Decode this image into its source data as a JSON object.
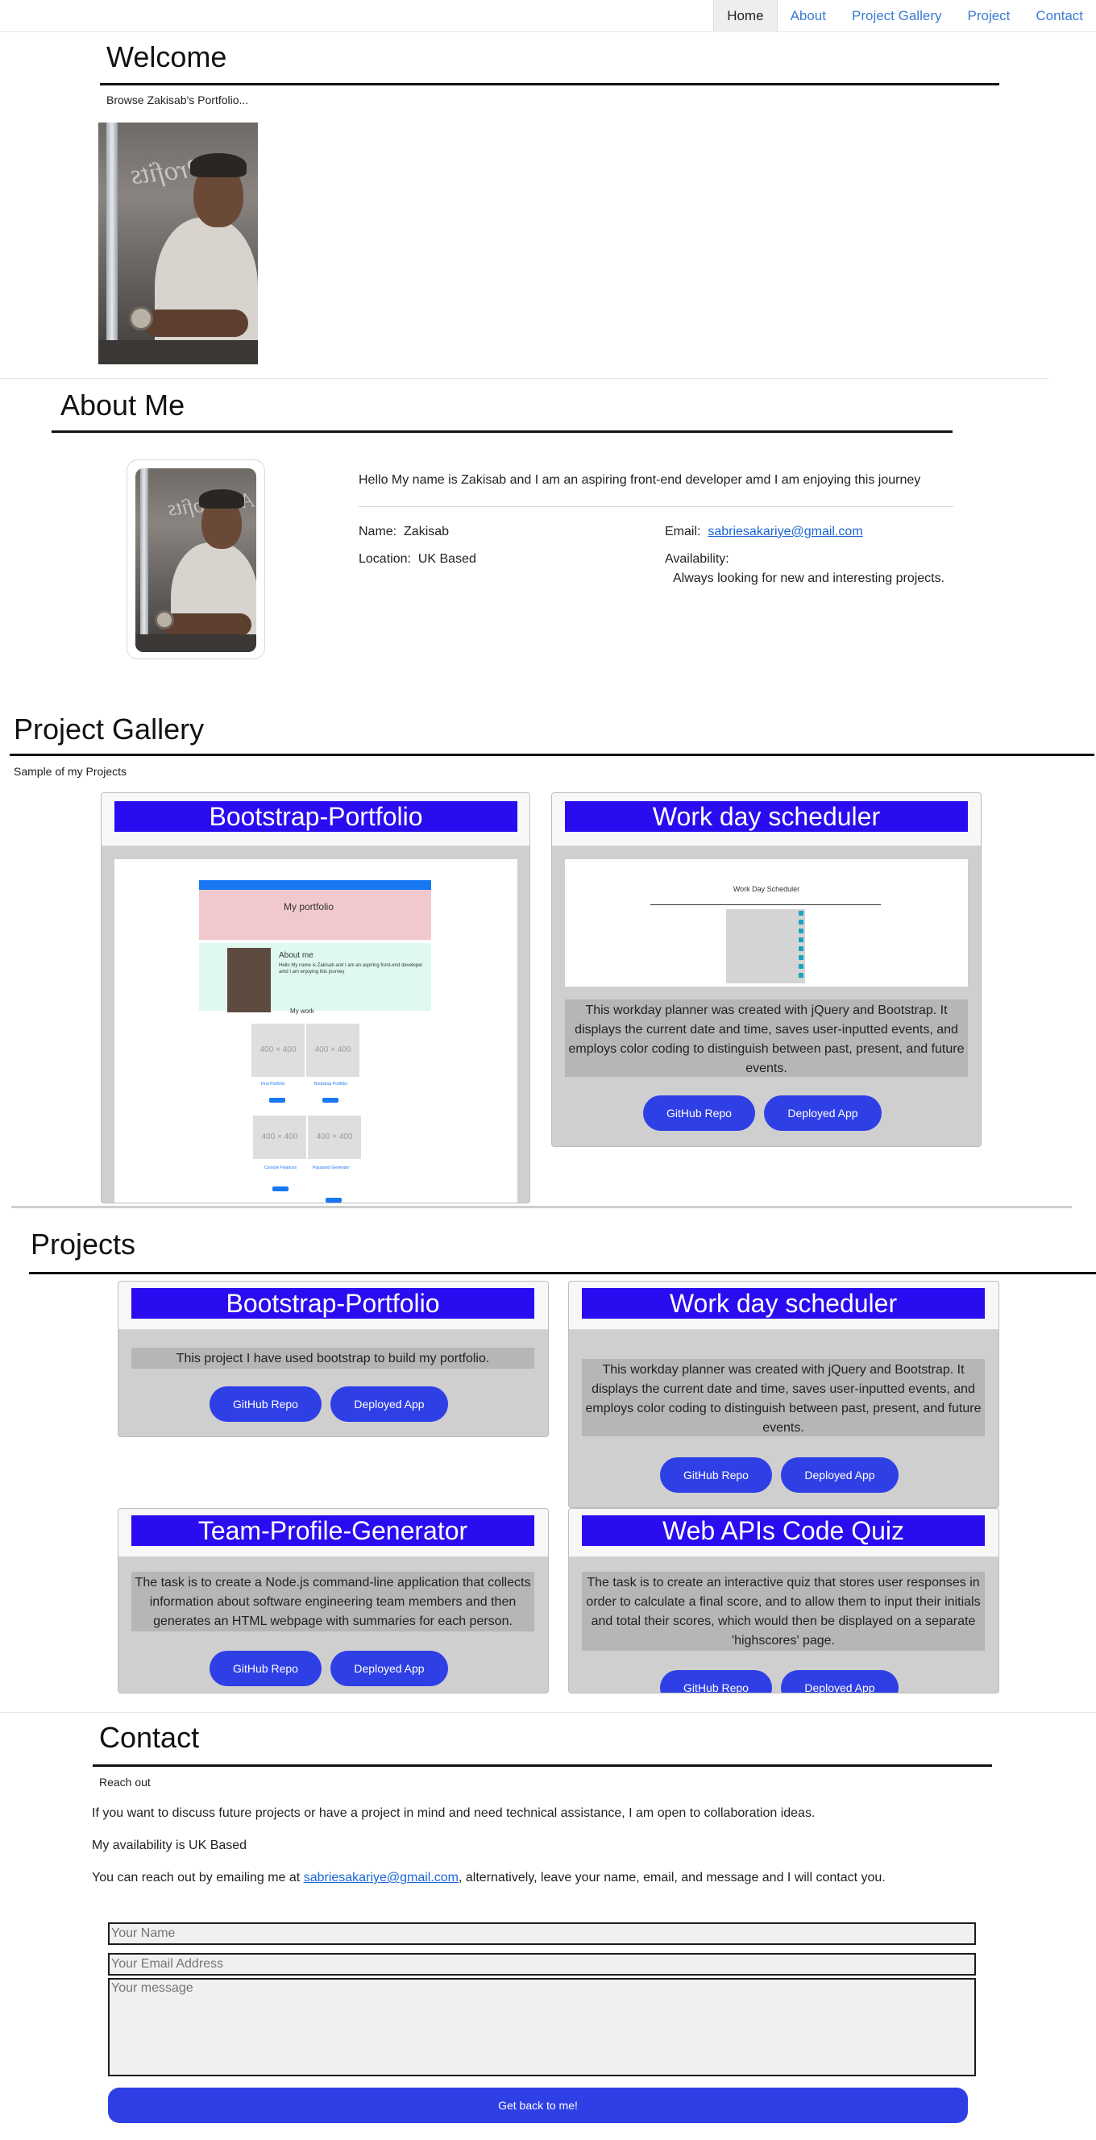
{
  "nav": {
    "items": [
      {
        "label": "Home",
        "active": true
      },
      {
        "label": "About",
        "active": false
      },
      {
        "label": "Project Gallery",
        "active": false
      },
      {
        "label": "Project",
        "active": false
      },
      {
        "label": "Contact",
        "active": false
      }
    ]
  },
  "welcome": {
    "title": "Welcome",
    "subtitle": "Browse Zakisab's Portfolio..."
  },
  "about": {
    "title": "About Me",
    "intro": "Hello My name is Zakisab and I am an aspiring front-end developer amd I am enjoying this journey",
    "name_label": "Name:",
    "name_value": "Zakisab",
    "location_label": "Location:",
    "location_value": "UK Based",
    "email_label": "Email:",
    "email_value": "sabriesakariye@gmail.com",
    "availability_label": "Availability:",
    "availability_value": "Always looking for new and interesting projects."
  },
  "gallery": {
    "title": "Project Gallery",
    "subtitle": "Sample of my Projects",
    "cards": [
      {
        "title": "Bootstrap-Portfolio",
        "preview": {
          "hero_title": "My portfolio",
          "about_title": "About me",
          "about_text": "Hello My name is Zakisab and I am an aspiring front-end developer amd I am enjoying this journey",
          "work_title": "My work",
          "tile_label": "400 × 400",
          "tile_names": [
            "First Portfolio",
            "Bootstrap Portfolio",
            "Console Finances",
            "Password Generator"
          ]
        }
      },
      {
        "title": "Work day scheduler",
        "preview": {
          "app_title": "Work Day Scheduler"
        },
        "description": "This workday planner was created with jQuery and Bootstrap. It displays the current date and time, saves user-inputted events, and employs color coding to distinguish between past, present, and future events.",
        "github_label": "GitHub Repo",
        "deployed_label": "Deployed App"
      }
    ]
  },
  "projects": {
    "title": "Projects",
    "cards": [
      {
        "title": "Bootstrap-Portfolio",
        "description": "This project I have used bootstrap to build my portfolio.",
        "github_label": "GitHub Repo",
        "deployed_label": "Deployed App"
      },
      {
        "title": "Work day scheduler",
        "description": "This workday planner was created with jQuery and Bootstrap. It displays the current date and time, saves user-inputted events, and employs color coding to distinguish between past, present, and future events.",
        "github_label": "GitHub Repo",
        "deployed_label": "Deployed App"
      },
      {
        "title": "Team-Profile-Generator",
        "description": "The task is to create a Node.js command-line application that collects information about software engineering team members and then generates an HTML webpage with summaries for each person.",
        "github_label": "GitHub Repo",
        "deployed_label": "Deployed App"
      },
      {
        "title": "Web APIs Code Quiz",
        "description": "The task is to create an interactive quiz that stores user responses in order to calculate a final score, and to allow them to input their initials and total their scores, which would then be displayed on a separate 'highscores' page.",
        "github_label": "GitHub Repo",
        "deployed_label": "Deployed App"
      }
    ]
  },
  "contact": {
    "title": "Contact",
    "subtitle": "Reach out",
    "para1": "If you want to discuss future projects or have a project in mind and need technical assistance, I am open to collaboration ideas.",
    "para2": "My availability is UK Based",
    "para3_before": "You can reach out by emailing me at ",
    "email": "sabriesakariye@gmail.com",
    "para3_after": ", alternatively, leave your name, email, and message and I will contact you.",
    "name_placeholder": "Your Name",
    "email_placeholder": "Your Email Address",
    "message_placeholder": "Your message",
    "submit_label": "Get back to me!"
  },
  "colors": {
    "accent": "#2a0cf0",
    "button": "#2f3fe6",
    "card_bg": "#cfcfcf",
    "desc_bg": "#b6b6b6"
  }
}
